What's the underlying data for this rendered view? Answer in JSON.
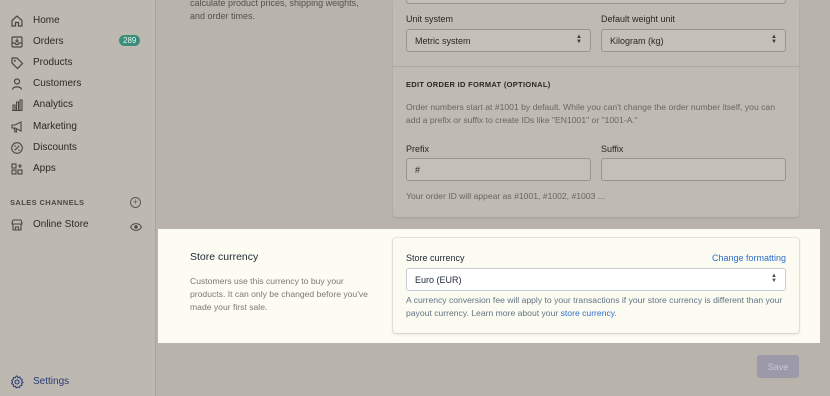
{
  "sidebar": {
    "items": [
      {
        "label": "Home",
        "icon": "home-icon"
      },
      {
        "label": "Orders",
        "icon": "orders-icon",
        "badge": "289"
      },
      {
        "label": "Products",
        "icon": "tag-icon"
      },
      {
        "label": "Customers",
        "icon": "person-icon"
      },
      {
        "label": "Analytics",
        "icon": "bar-chart-icon"
      },
      {
        "label": "Marketing",
        "icon": "megaphone-icon"
      },
      {
        "label": "Discounts",
        "icon": "discount-icon"
      },
      {
        "label": "Apps",
        "icon": "apps-icon"
      }
    ],
    "sales_channels_label": "SALES CHANNELS",
    "online_store_label": "Online Store",
    "settings_label": "Settings"
  },
  "standards": {
    "description_partial": "calculate product prices, shipping weights, and order times.",
    "unit_system_label": "Unit system",
    "unit_system_value": "Metric system",
    "weight_unit_label": "Default weight unit",
    "weight_unit_value": "Kilogram (kg)"
  },
  "order_id": {
    "heading": "EDIT ORDER ID FORMAT (OPTIONAL)",
    "help": "Order numbers start at #1001 by default. While you can't change the order number itself, you can add a prefix or suffix to create IDs like \"EN1001\" or \"1001-A.\"",
    "prefix_label": "Prefix",
    "prefix_value": "#",
    "suffix_label": "Suffix",
    "suffix_value": "",
    "preview": "Your order ID will appear as #1001, #1002, #1003 ..."
  },
  "currency": {
    "title": "Store currency",
    "description": "Customers use this currency to buy your products. It can only be changed before you've made your first sale.",
    "field_label": "Store currency",
    "change_formatting": "Change formatting",
    "selected": "Euro (EUR)",
    "help_prefix": "A currency conversion fee will apply to your transactions if your store currency is different than your payout currency. Learn more about your ",
    "help_link": "store currency",
    "help_suffix": "."
  },
  "save_label": "Save",
  "colors": {
    "badge": "#3a8d7a",
    "link": "#2c6ecb",
    "highlight": "#fcfcf3",
    "overlay": "#b9b4ab"
  }
}
